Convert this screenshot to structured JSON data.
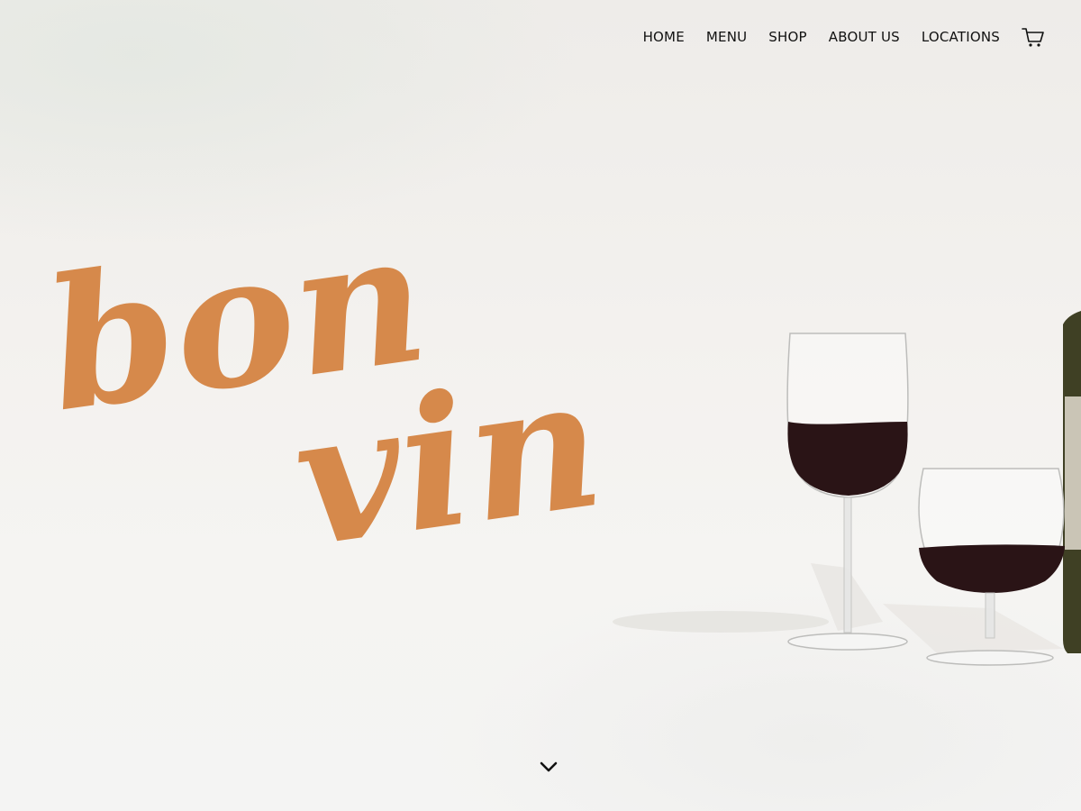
{
  "nav": {
    "items": [
      {
        "label": "HOME"
      },
      {
        "label": "MENU"
      },
      {
        "label": "SHOP"
      },
      {
        "label": "ABOUT US"
      },
      {
        "label": "LOCATIONS"
      }
    ],
    "cart_icon": "cart-icon"
  },
  "hero": {
    "logo_line1": "bon",
    "logo_line2": "vin",
    "logo_color": "#d6894b",
    "scroll_icon": "chevron-down-icon"
  }
}
